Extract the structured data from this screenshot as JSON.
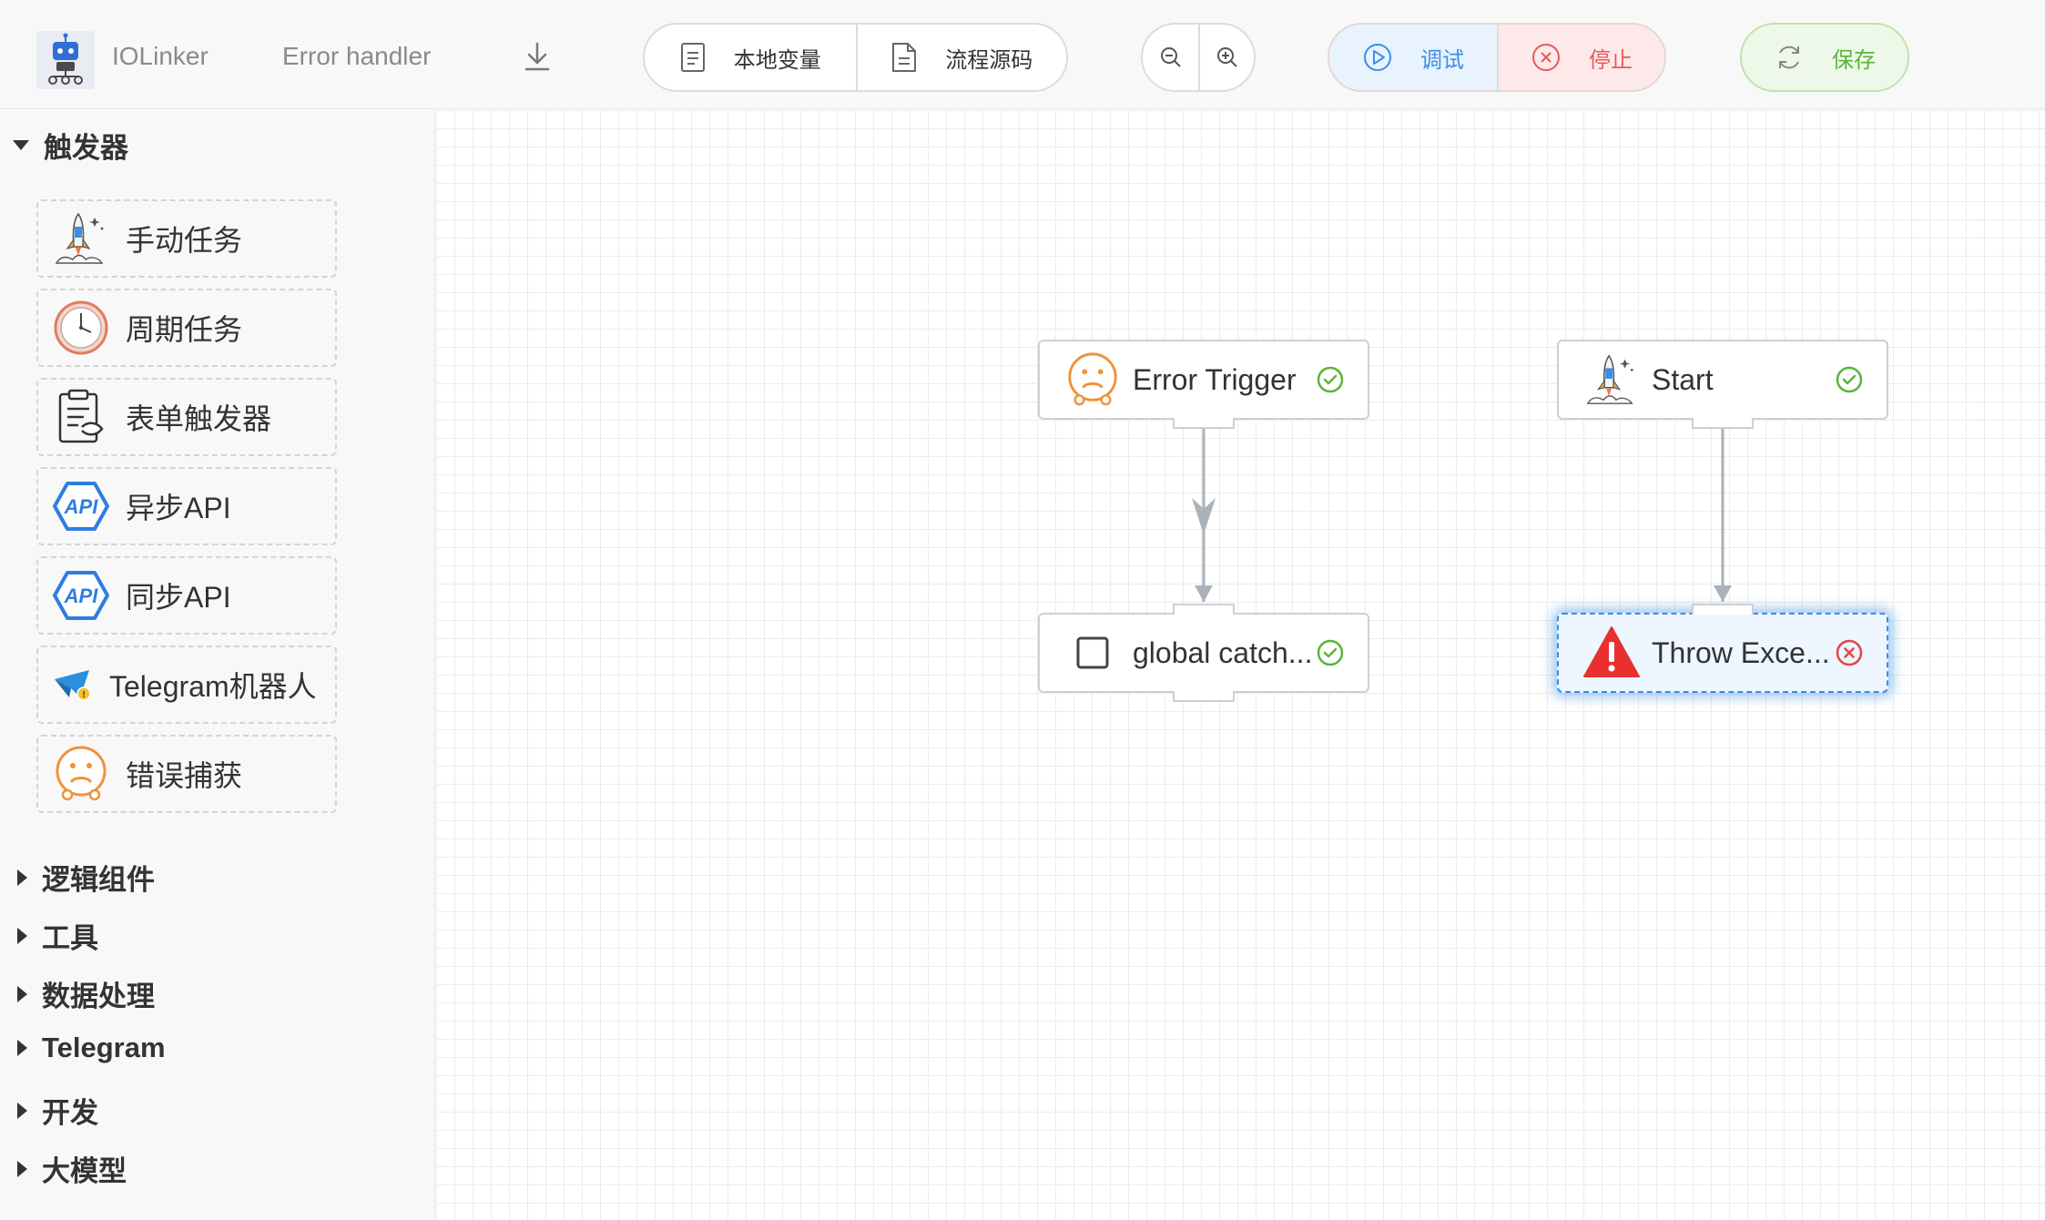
{
  "header": {
    "app_name": "IOLinker",
    "flow_name": "Error handler",
    "local_vars_label": "本地变量",
    "source_code_label": "流程源码",
    "debug_label": "调试",
    "stop_label": "停止",
    "save_label": "保存"
  },
  "sidebar": {
    "triggers": {
      "title": "触发器",
      "expanded": true,
      "items": [
        {
          "label": "手动任务",
          "icon": "rocket-icon"
        },
        {
          "label": "周期任务",
          "icon": "clock-icon"
        },
        {
          "label": "表单触发器",
          "icon": "clipboard-icon"
        },
        {
          "label": "异步API",
          "icon": "api-icon"
        },
        {
          "label": "同步API",
          "icon": "api-icon"
        },
        {
          "label": "Telegram机器人",
          "icon": "telegram-icon"
        },
        {
          "label": "错误捕获",
          "icon": "sad-face-icon"
        }
      ]
    },
    "categories": [
      {
        "label": "逻辑组件"
      },
      {
        "label": "工具"
      },
      {
        "label": "数据处理"
      },
      {
        "label": "Telegram"
      },
      {
        "label": "开发"
      },
      {
        "label": "大模型"
      }
    ]
  },
  "canvas": {
    "nodes": [
      {
        "label": "Error Trigger",
        "icon": "sad-face-icon",
        "status": "success"
      },
      {
        "label": "global catch...",
        "icon": "checkbox-icon",
        "status": "success"
      },
      {
        "label": "Start",
        "icon": "rocket-icon",
        "status": "success"
      },
      {
        "label": "Throw Exce...",
        "icon": "warning-icon",
        "status": "error",
        "selected": true
      }
    ]
  },
  "colors": {
    "accent_blue": "#3c8fe6",
    "danger_red": "#e65a5a",
    "success_green": "#5bb53a",
    "edge_gray": "#a9b1bb"
  }
}
